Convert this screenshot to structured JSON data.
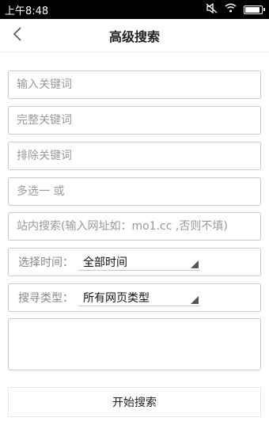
{
  "status_bar": {
    "time": "上午8:48",
    "battery_level": 0.9
  },
  "header": {
    "title": "高级搜索",
    "back_icon": "chevron-left-icon"
  },
  "form": {
    "keywords_placeholder": "输入关键词",
    "exact_placeholder": "完整关键词",
    "exclude_placeholder": "排除关键词",
    "any_placeholder": "多选一 或",
    "site_placeholder": "站内搜索(输入网址如：mo1.cc ,否则不填)",
    "time_label": "选择时间：",
    "time_value": "全部时间",
    "type_label": "搜寻类型：",
    "type_value": "所有网页类型",
    "textarea_value": ""
  },
  "actions": {
    "start_label": "开始搜索"
  }
}
